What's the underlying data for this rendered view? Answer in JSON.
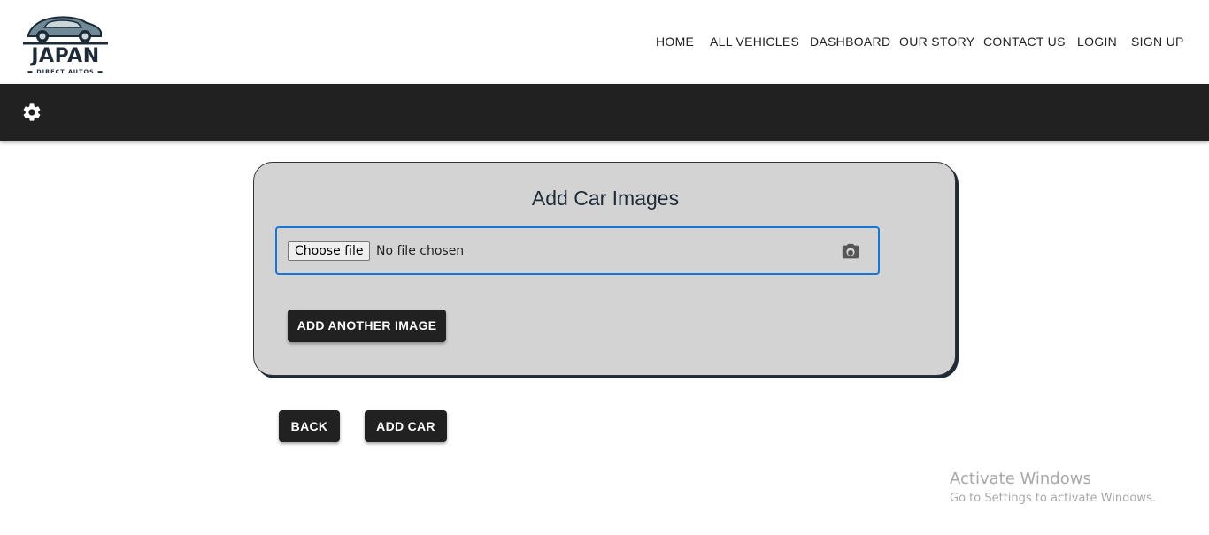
{
  "brand": {
    "name": "JAPAN",
    "tagline": "DIRECT AUTOS",
    "icon": "car-logo-icon"
  },
  "nav": {
    "items": [
      {
        "label": "HOME"
      },
      {
        "label": "ALL VEHICLES"
      },
      {
        "label": "DASHBOARD"
      },
      {
        "label": "OUR STORY"
      },
      {
        "label": "CONTACT US"
      },
      {
        "label": "LOGIN"
      },
      {
        "label": "SIGN UP"
      }
    ]
  },
  "toolbar": {
    "settings_icon": "gear-icon"
  },
  "form": {
    "title": "Add Car Images",
    "file_input": {
      "button_label": "Choose file",
      "status": "No file chosen",
      "icon": "camera-icon"
    },
    "add_image_label": "ADD ANOTHER IMAGE"
  },
  "actions": {
    "back_label": "BACK",
    "add_car_label": "ADD CAR"
  },
  "watermark": {
    "title": "Activate Windows",
    "subtitle": "Go to Settings to activate Windows."
  },
  "colors": {
    "toolbar_bg": "#212121",
    "card_bg": "#d3d3d3",
    "focus_border": "#1976d2",
    "button_bg": "#212121",
    "brand_dark": "#1e2a38"
  }
}
